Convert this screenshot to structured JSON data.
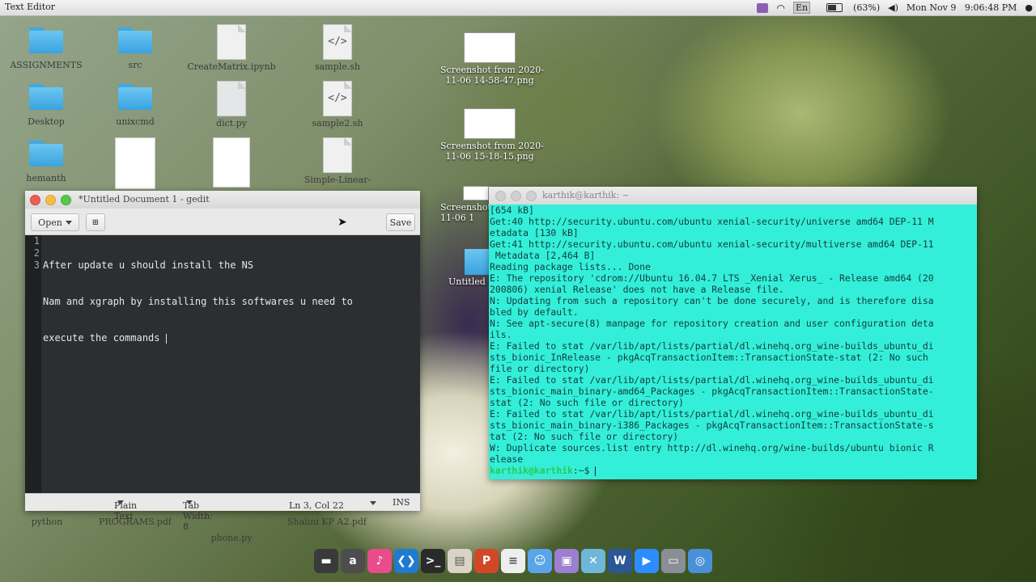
{
  "menubar": {
    "app_name": "Text Editor",
    "battery": "(63%)",
    "input_method": "En",
    "clock": "Mon Nov 9   9:06:48 PM"
  },
  "desktop_icons": [
    {
      "label": "ASSIGNMENTS",
      "kind": "folder"
    },
    {
      "label": "src",
      "kind": "folder"
    },
    {
      "label": "CreateMatrix.ipynb",
      "kind": "file"
    },
    {
      "label": "sample.sh",
      "kind": "code"
    },
    {
      "label": "Desktop",
      "kind": "folder"
    },
    {
      "label": "unixcmd",
      "kind": "folder"
    },
    {
      "label": "dict.py",
      "kind": "file"
    },
    {
      "label": "sample2.sh",
      "kind": "code"
    },
    {
      "label": "hemanth",
      "kind": "folder"
    },
    {
      "label": "Simple-Linear-",
      "kind": "file"
    },
    {
      "label": "Screenshot from 2020-\n11-06 14-58-47.png",
      "kind": "image"
    },
    {
      "label": "Screenshot from 2020-\n11-06 15-18-15.png",
      "kind": "image"
    },
    {
      "label": "Screenshot\n11-06 1",
      "kind": "image"
    },
    {
      "label": "Untitled",
      "kind": "folder"
    },
    {
      "label": "python",
      "kind": "text"
    },
    {
      "label": "PROGRAMS.pdf",
      "kind": "text"
    },
    {
      "label": "phone.py",
      "kind": "text"
    },
    {
      "label": "Shalini KP A2.pdf",
      "kind": "text"
    }
  ],
  "gedit": {
    "title": "*Untitled Document 1 - gedit",
    "open_label": "Open",
    "save_label": "Save",
    "lines": [
      {
        "num": "1",
        "text": "After update u should install the NS"
      },
      {
        "num": "2",
        "text": "Nam and xgraph by installing this softwares u need to"
      },
      {
        "num": "3",
        "text": "execute the commands "
      }
    ],
    "status": {
      "language": "Plain Text",
      "tab_width": "Tab Width: 8",
      "position": "Ln 3, Col 22",
      "mode": "INS"
    }
  },
  "terminal": {
    "title": "karthik@karthik: ~",
    "lines": [
      "[654 kB]",
      "Get:40 http://security.ubuntu.com/ubuntu xenial-security/universe amd64 DEP-11 M",
      "etadata [130 kB]",
      "Get:41 http://security.ubuntu.com/ubuntu xenial-security/multiverse amd64 DEP-11",
      " Metadata [2,464 B]",
      "Reading package lists... Done",
      "E: The repository 'cdrom://Ubuntu 16.04.7 LTS _Xenial Xerus_ - Release amd64 (20",
      "200806) xenial Release' does not have a Release file.",
      "N: Updating from such a repository can't be done securely, and is therefore disa",
      "bled by default.",
      "N: See apt-secure(8) manpage for repository creation and user configuration deta",
      "ils.",
      "E: Failed to stat /var/lib/apt/lists/partial/dl.winehq.org_wine-builds_ubuntu_di",
      "sts_bionic_InRelease - pkgAcqTransactionItem::TransactionState-stat (2: No such",
      "file or directory)",
      "E: Failed to stat /var/lib/apt/lists/partial/dl.winehq.org_wine-builds_ubuntu_di",
      "sts_bionic_main_binary-amd64_Packages - pkgAcqTransactionItem::TransactionState-",
      "stat (2: No such file or directory)",
      "E: Failed to stat /var/lib/apt/lists/partial/dl.winehq.org_wine-builds_ubuntu_di",
      "sts_bionic_main_binary-i386_Packages - pkgAcqTransactionItem::TransactionState-s",
      "tat (2: No such file or directory)",
      "W: Duplicate sources.list entry http://dl.winehq.org/wine-builds/ubuntu bionic R",
      "elease"
    ],
    "prompt_user": "karthik@karthik",
    "prompt_suffix": ":~$ "
  },
  "dock": [
    {
      "name": "screen-app-icon",
      "color": "#3a3a3a",
      "glyph": "▬"
    },
    {
      "name": "amazon-icon",
      "color": "#4d4d4d",
      "glyph": "a"
    },
    {
      "name": "music-icon",
      "color": "#e84c8a",
      "glyph": "♪"
    },
    {
      "name": "vscode-icon",
      "color": "#1f7bd0",
      "glyph": "❮❯"
    },
    {
      "name": "terminal-icon",
      "color": "#2a2a2a",
      "glyph": ">_"
    },
    {
      "name": "files-icon",
      "color": "#d9d4c7",
      "glyph": "▤"
    },
    {
      "name": "presentation-icon",
      "color": "#d24726",
      "glyph": "P"
    },
    {
      "name": "document-icon",
      "color": "#eeeeee",
      "glyph": "≡"
    },
    {
      "name": "finder-icon",
      "color": "#5aa4e8",
      "glyph": "☺"
    },
    {
      "name": "media-icon",
      "color": "#9c7fd1",
      "glyph": "▣"
    },
    {
      "name": "tools-icon",
      "color": "#6fb7d9",
      "glyph": "✕"
    },
    {
      "name": "word-icon",
      "color": "#2b5797",
      "glyph": "W"
    },
    {
      "name": "zoom-icon",
      "color": "#2d8cff",
      "glyph": "▶"
    },
    {
      "name": "screenshot-icon",
      "color": "#8a8f96",
      "glyph": "▭"
    },
    {
      "name": "browser-icon",
      "color": "#4a90d9",
      "glyph": "◎"
    }
  ]
}
